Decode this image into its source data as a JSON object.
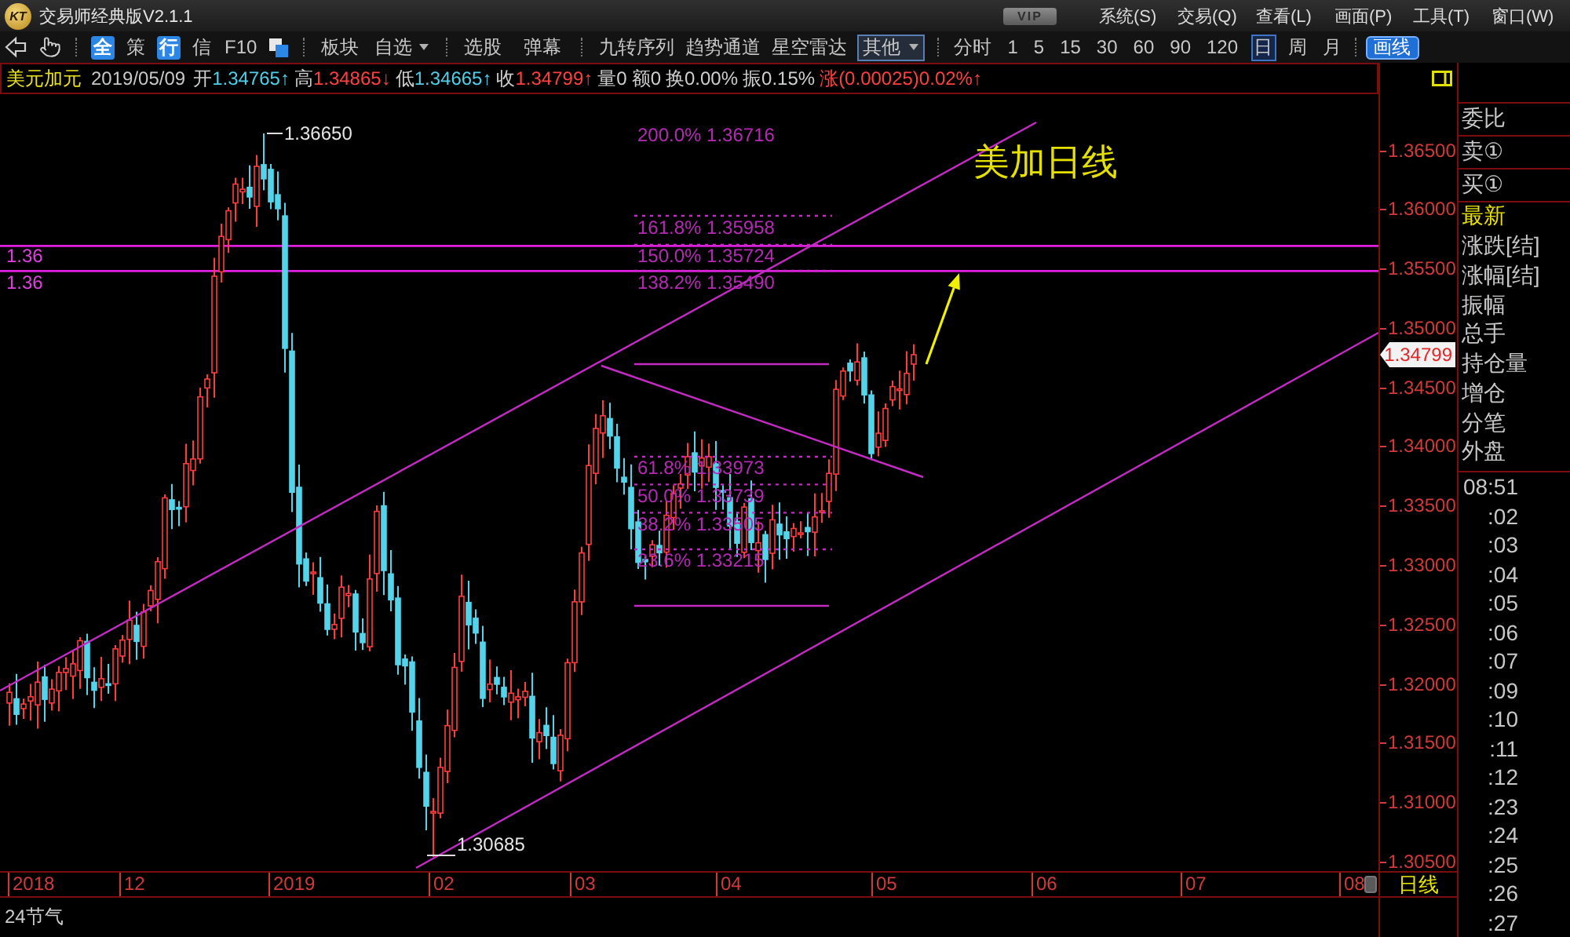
{
  "title_bar": {
    "logo": "KT",
    "title": "交易师经典版V2.1.1",
    "badge": "VIP",
    "menus": [
      "系统(S)",
      "交易(Q)",
      "查看(L)",
      "画面(P)",
      "工具(T)",
      "窗口(W)"
    ]
  },
  "toolbar": {
    "quick_buttons": [
      {
        "label": "全",
        "highlighted": true
      },
      {
        "label": "策",
        "highlighted": false
      },
      {
        "label": "行",
        "highlighted": true
      },
      {
        "label": "信",
        "highlighted": false
      },
      {
        "label": "F10",
        "highlighted": false
      }
    ],
    "list_buttons": [
      {
        "label": "板块",
        "dropdown": false
      },
      {
        "label": "自选",
        "dropdown": true
      }
    ],
    "tool_buttons": [
      "选股",
      "弹幕"
    ],
    "indicator_buttons": [
      {
        "label": "九转序列",
        "selected": false,
        "dropdown": false
      },
      {
        "label": "趋势通道",
        "selected": false,
        "dropdown": false
      },
      {
        "label": "星空雷达",
        "selected": false,
        "dropdown": false
      },
      {
        "label": "其他",
        "selected": true,
        "dropdown": true
      }
    ],
    "periods": [
      {
        "label": "分时",
        "selected": false
      },
      {
        "label": "1",
        "selected": false
      },
      {
        "label": "5",
        "selected": false
      },
      {
        "label": "15",
        "selected": false
      },
      {
        "label": "30",
        "selected": false
      },
      {
        "label": "60",
        "selected": false
      },
      {
        "label": "90",
        "selected": false
      },
      {
        "label": "120",
        "selected": false
      },
      {
        "label": "日",
        "selected": true
      },
      {
        "label": "周",
        "selected": false
      },
      {
        "label": "月",
        "selected": false
      }
    ],
    "draw_button": "画线"
  },
  "quote_bar": {
    "symbol": "美元加元",
    "date": "2019/05/09",
    "fields": [
      {
        "kind": "price",
        "label": "开",
        "value": "1.34765↑",
        "rising": false
      },
      {
        "kind": "price",
        "label": "高",
        "value": "1.34865↓",
        "rising": true
      },
      {
        "kind": "price",
        "label": "低",
        "value": "1.34665↑",
        "rising": false
      },
      {
        "kind": "price",
        "label": "收",
        "value": "1.34799↑",
        "rising": true
      },
      {
        "kind": "stat",
        "label": "量",
        "value": "0"
      },
      {
        "kind": "stat",
        "label": "额",
        "value": "0"
      },
      {
        "kind": "stat",
        "label": "换",
        "value": "0.00%"
      },
      {
        "kind": "stat",
        "label": "振",
        "value": "0.15%"
      },
      {
        "kind": "change",
        "label": "涨",
        "value": "(0.00025)0.02%↑",
        "rising": true
      }
    ]
  },
  "chart": {
    "note": "美加日线",
    "high_label": "1.36650",
    "low_label": "1.30685",
    "level_lines": [
      "1.36",
      "1.36"
    ],
    "extension_top_label": "200.0% 1.36716",
    "extension_levels": [
      "161.8% 1.35958",
      "150.0% 1.35724",
      "138.2% 1.35490"
    ],
    "retracement_levels": [
      "61.8% 1.33973",
      "50.0% 1.33739",
      "38.2% 1.33505",
      "23.6% 1.33215"
    ]
  },
  "price_axis": {
    "labels": [
      "1.36500",
      "1.36000",
      "1.35500",
      "1.35000",
      "1.34500",
      "1.34000",
      "1.33500",
      "1.33000",
      "1.32500",
      "1.32000",
      "1.31500",
      "1.31000",
      "1.30500"
    ],
    "current_price": "1.34799",
    "period_label": "日线"
  },
  "time_axis": {
    "labels": [
      "2018",
      "12",
      "2019",
      "02",
      "03",
      "04",
      "05",
      "06",
      "07",
      "08"
    ]
  },
  "quote_panel": {
    "order_rows": [
      "委比",
      "卖①",
      "买①"
    ],
    "fields": [
      {
        "label": "最新",
        "highlighted": true
      },
      {
        "label": "涨跌[结]",
        "highlighted": false
      },
      {
        "label": "涨幅[结]",
        "highlighted": false
      },
      {
        "label": "振幅",
        "highlighted": false
      },
      {
        "label": "总手",
        "highlighted": false
      },
      {
        "label": "持仓量",
        "highlighted": false
      },
      {
        "label": "增仓",
        "highlighted": false
      },
      {
        "label": "分笔",
        "highlighted": false
      },
      {
        "label": "外盘",
        "highlighted": false
      }
    ],
    "ticks": [
      "08:51",
      ":02",
      ":03",
      ":04",
      ":05",
      ":06",
      ":07",
      ":09",
      ":10",
      ":11",
      ":12",
      ":23",
      ":24",
      ":25",
      ":26",
      ":27"
    ]
  },
  "status_bar": {
    "label": "24节气"
  }
}
